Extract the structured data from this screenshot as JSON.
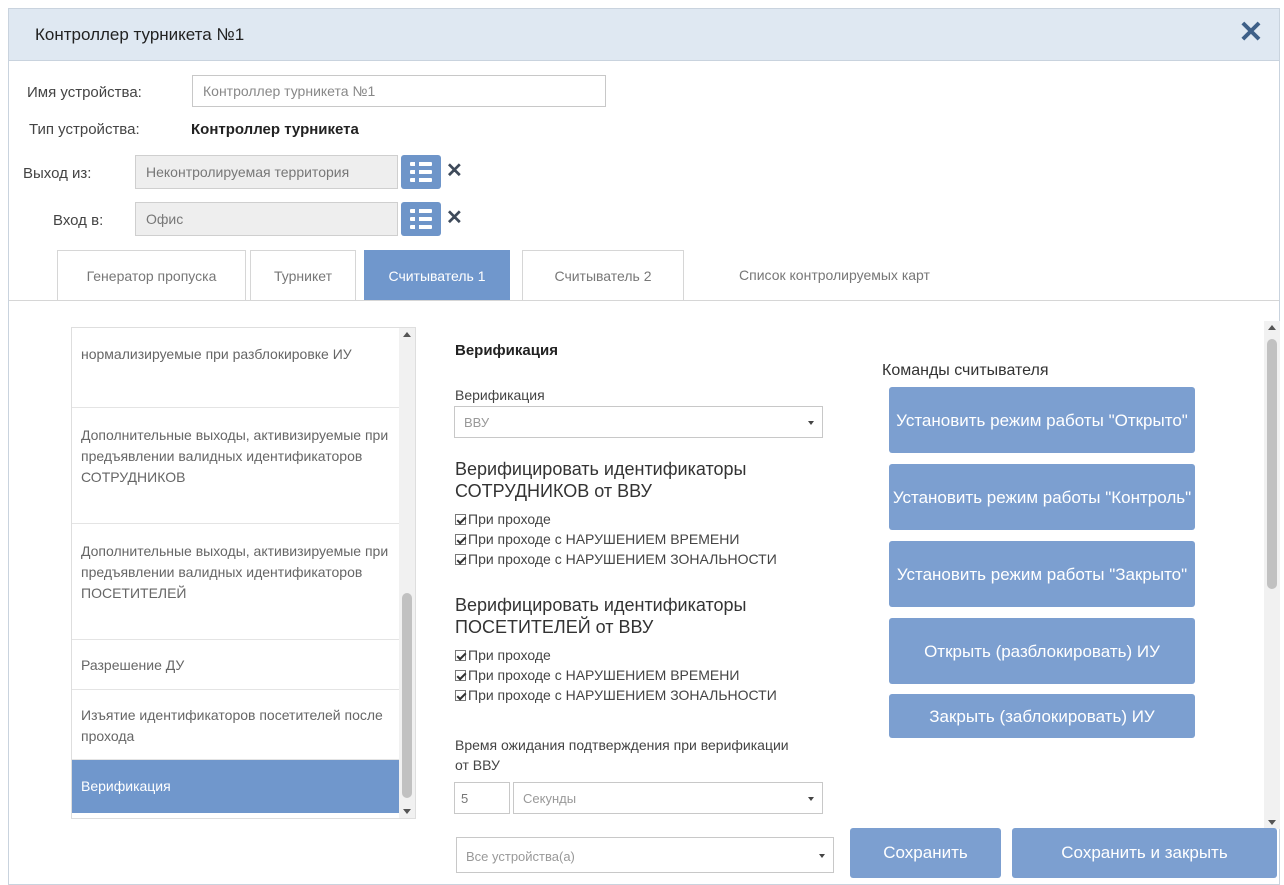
{
  "window": {
    "title": "Контроллер турникета №1"
  },
  "device": {
    "name_label": "Имя устройства:",
    "name_value": "Контроллер турникета №1",
    "type_label": "Тип устройства:",
    "type_value": "Контроллер турникета",
    "exit_label": "Выход из:",
    "exit_value": "Неконтролируемая территория",
    "entry_label": "Вход в:",
    "entry_value": "Офис"
  },
  "tabs": [
    {
      "label": "Генератор пропуска"
    },
    {
      "label": "Турникет"
    },
    {
      "label": "Считыватель 1"
    },
    {
      "label": "Считыватель 2"
    },
    {
      "label": "Список контролируемых карт"
    }
  ],
  "left_menu": [
    {
      "label": "нормализируемые при разблокировке ИУ"
    },
    {
      "label": "Дополнительные выходы, активизируемые при предъявлении валидных идентификаторов СОТРУДНИКОВ"
    },
    {
      "label": "Дополнительные выходы, активизируемые при предъявлении валидных идентификаторов ПОСЕТИТЕЛЕЙ"
    },
    {
      "label": "Разрешение ДУ"
    },
    {
      "label": "Изъятие идентификаторов посетителей после прохода"
    },
    {
      "label": "Верификация"
    }
  ],
  "verification": {
    "section_title": "Верификация",
    "field_label": "Верификация",
    "select_value": "ВВУ",
    "employees_title": "Верифицировать идентификаторы СОТРУДНИКОВ от ВВУ",
    "employees_options": [
      {
        "label": "При проходе",
        "checked": true
      },
      {
        "label": "При проходе с НАРУШЕНИЕМ ВРЕМЕНИ",
        "checked": true
      },
      {
        "label": "При проходе с НАРУШЕНИЕМ ЗОНАЛЬНОСТИ",
        "checked": true
      }
    ],
    "visitors_title": "Верифицировать идентификаторы ПОСЕТИТЕЛЕЙ от ВВУ",
    "visitors_options": [
      {
        "label": "При проходе",
        "checked": true
      },
      {
        "label": "При проходе с НАРУШЕНИЕМ ВРЕМЕНИ",
        "checked": true
      },
      {
        "label": "При проходе с НАРУШЕНИЕМ ЗОНАЛЬНОСТИ",
        "checked": true
      }
    ],
    "wait_label": "Время ожидания подтверждения при верификации от ВВУ",
    "wait_value": "5",
    "wait_unit": "Секунды"
  },
  "commands": {
    "title": "Команды считывателя",
    "buttons": [
      {
        "label": "Установить режим работы \"Открыто\""
      },
      {
        "label": "Установить режим работы \"Контроль\""
      },
      {
        "label": "Установить режим работы \"Закрыто\""
      },
      {
        "label": "Открыть (разблокировать) ИУ"
      },
      {
        "label": "Закрыть (заблокировать) ИУ"
      }
    ]
  },
  "footer": {
    "devices_select": "Все устройства(а)",
    "save_label": "Сохранить",
    "save_close_label": "Сохранить и закрыть"
  }
}
